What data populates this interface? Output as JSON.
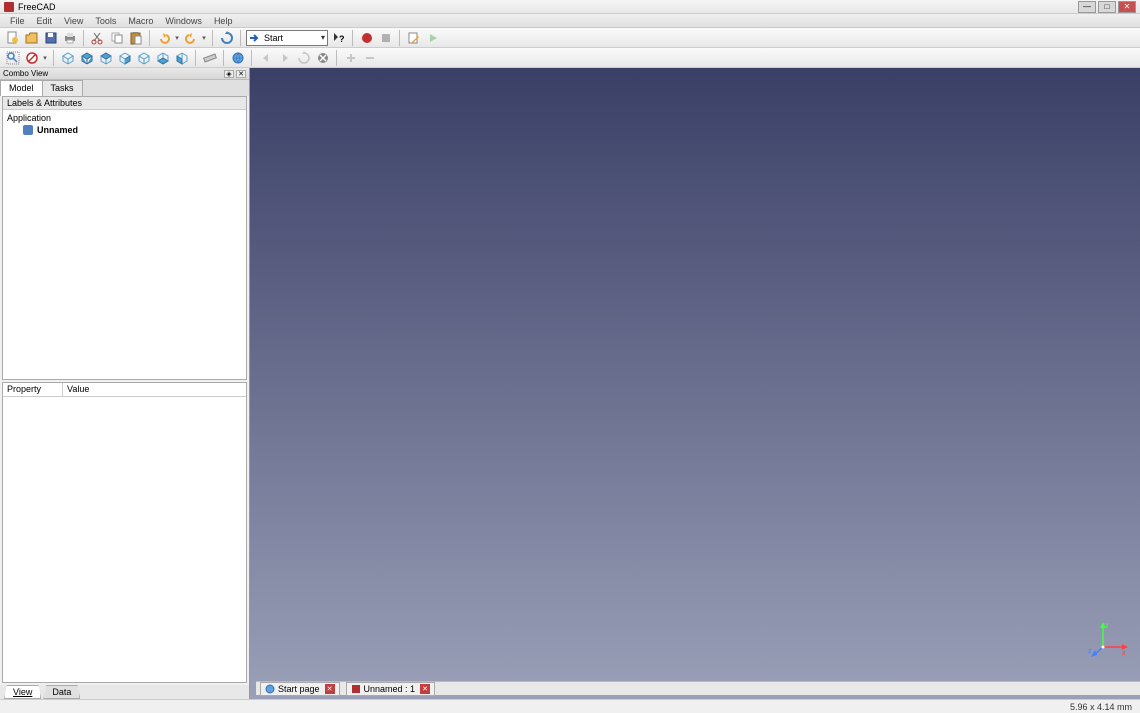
{
  "title": "FreeCAD",
  "menubar": [
    "File",
    "Edit",
    "View",
    "Tools",
    "Macro",
    "Windows",
    "Help"
  ],
  "toolbar1": {
    "dropdown_label": "Start",
    "whatsthis": "?"
  },
  "combo_panel": {
    "title": "Combo View",
    "tabs": [
      "Model",
      "Tasks"
    ],
    "tree_header": "Labels & Attributes",
    "tree_root": "Application",
    "tree_child": "Unnamed",
    "props_cols": [
      "Property",
      "Value"
    ],
    "props_tabs": [
      "View",
      "Data"
    ]
  },
  "doc_tabs": [
    {
      "label": "Start page",
      "closable": true
    },
    {
      "label": "Unnamed : 1",
      "closable": true
    }
  ],
  "statusbar": {
    "dimensions": "5.96 x 4.14 mm"
  },
  "axis": {
    "x": "x",
    "y": "y",
    "z": "z"
  }
}
